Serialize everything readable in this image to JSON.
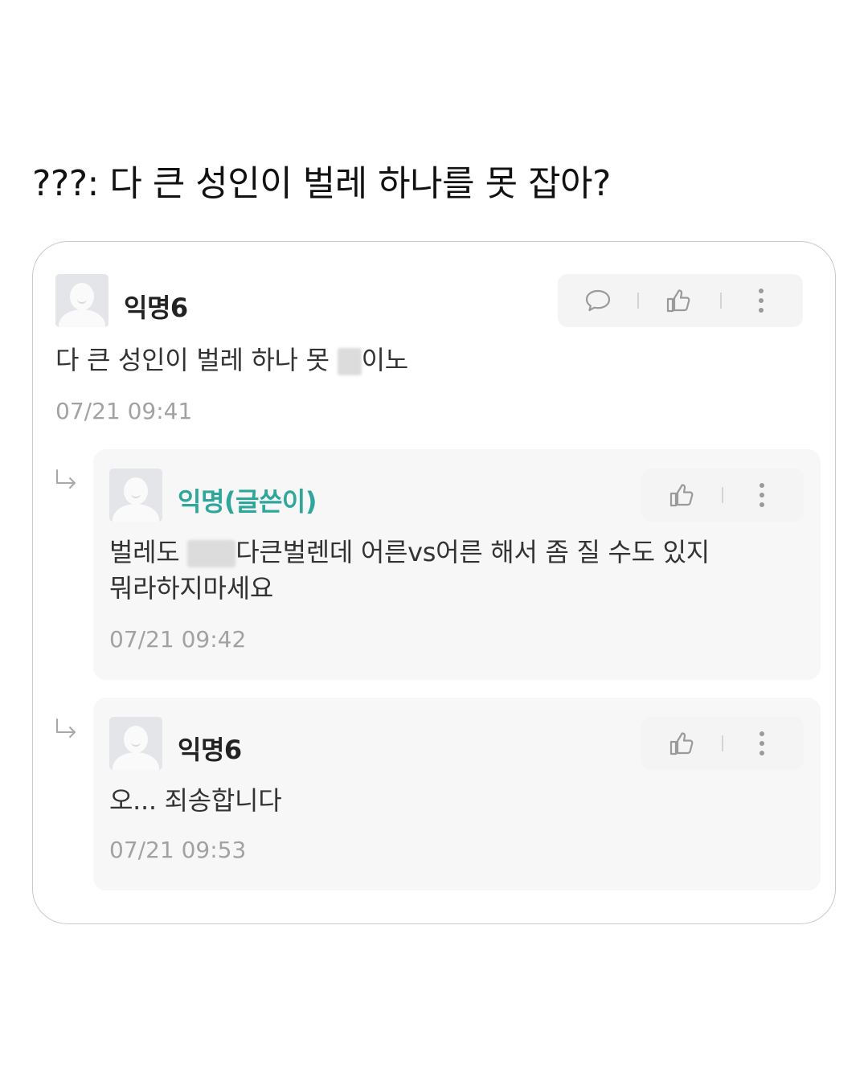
{
  "headline": "???: 다 큰 성인이 벌레 하나를 못 잡아?",
  "comments": [
    {
      "nickname": "익명6",
      "text_before": "다 큰 성인이 벌레 하나 못 ",
      "text_after": "이노",
      "time": "07/21 09:41"
    }
  ],
  "replies": [
    {
      "nickname": "익명(글쓴이)",
      "is_author": true,
      "line1_before": "벌레도 ",
      "line1_after": "다큰벌렌데 어른vs어른 해서 좀 질 수도 있지",
      "line2": "뭐라하지마세요",
      "time": "07/21 09:42"
    },
    {
      "nickname": "익명6",
      "is_author": false,
      "text": "오... 죄송합니다",
      "time": "07/21 09:53"
    }
  ],
  "icons": {
    "avatar": "default-avatar-icon",
    "reply": "chat-bubble-icon",
    "like": "thumbs-up-icon",
    "more": "more-vertical-icon",
    "reply_arrow": "reply-arrow-icon"
  },
  "colors": {
    "author_nickname": "#2ea79a",
    "timestamp": "#a2a2a2",
    "reply_background": "#f7f7f8",
    "action_background": "#f4f4f5"
  }
}
